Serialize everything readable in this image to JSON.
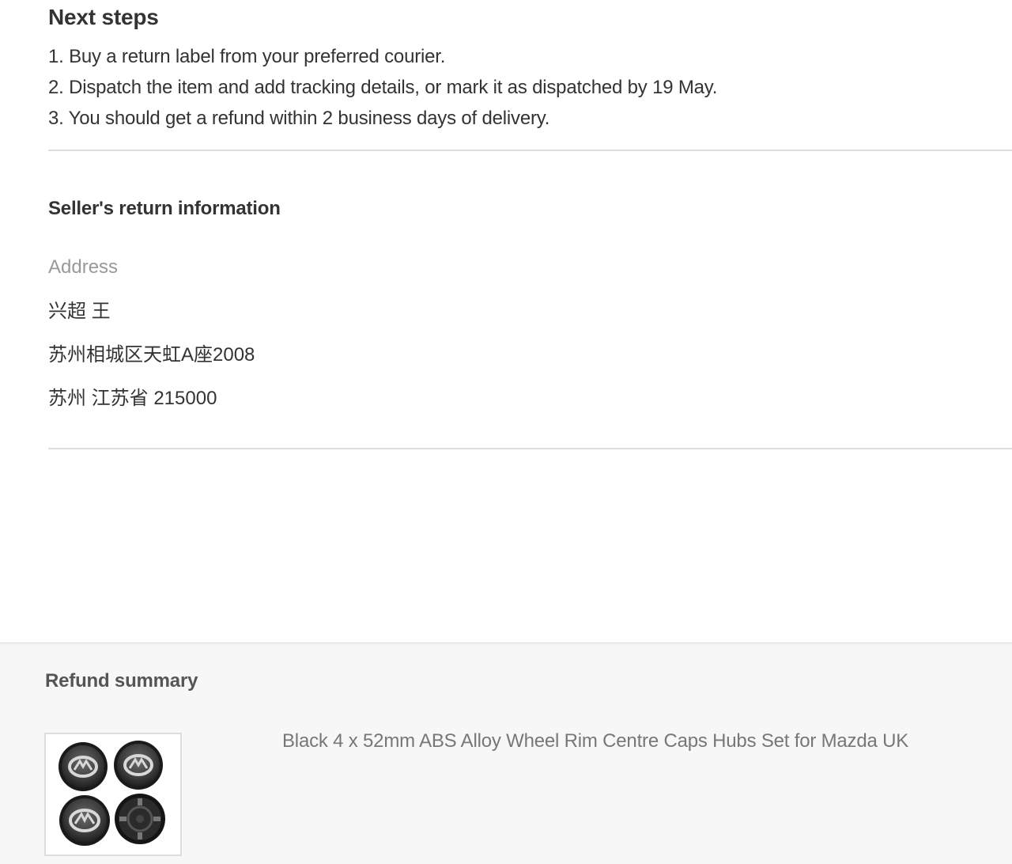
{
  "next_steps": {
    "title": "Next steps",
    "items": [
      "1. Buy a return label from your preferred courier.",
      "2. Dispatch the item and add tracking details, or mark it as dispatched by 19 May.",
      "3. You should get a refund within 2 business days of delivery."
    ]
  },
  "seller_return": {
    "title": "Seller's return information",
    "address_label": "Address",
    "address_lines": [
      "兴超 王",
      "苏州相城区天虹A座2008",
      "苏州 江苏省 215000"
    ]
  },
  "refund_summary": {
    "title": "Refund summary",
    "item": {
      "title": "Black 4 x 52mm ABS Alloy Wheel Rim Centre Caps Hubs Set for Mazda UK",
      "image_icon": "wheel-centre-caps-product-image"
    }
  },
  "colors": {
    "text": "#333333",
    "muted_label": "#999999",
    "divider": "#dddddd",
    "panel_bg": "#f7f7f7"
  }
}
